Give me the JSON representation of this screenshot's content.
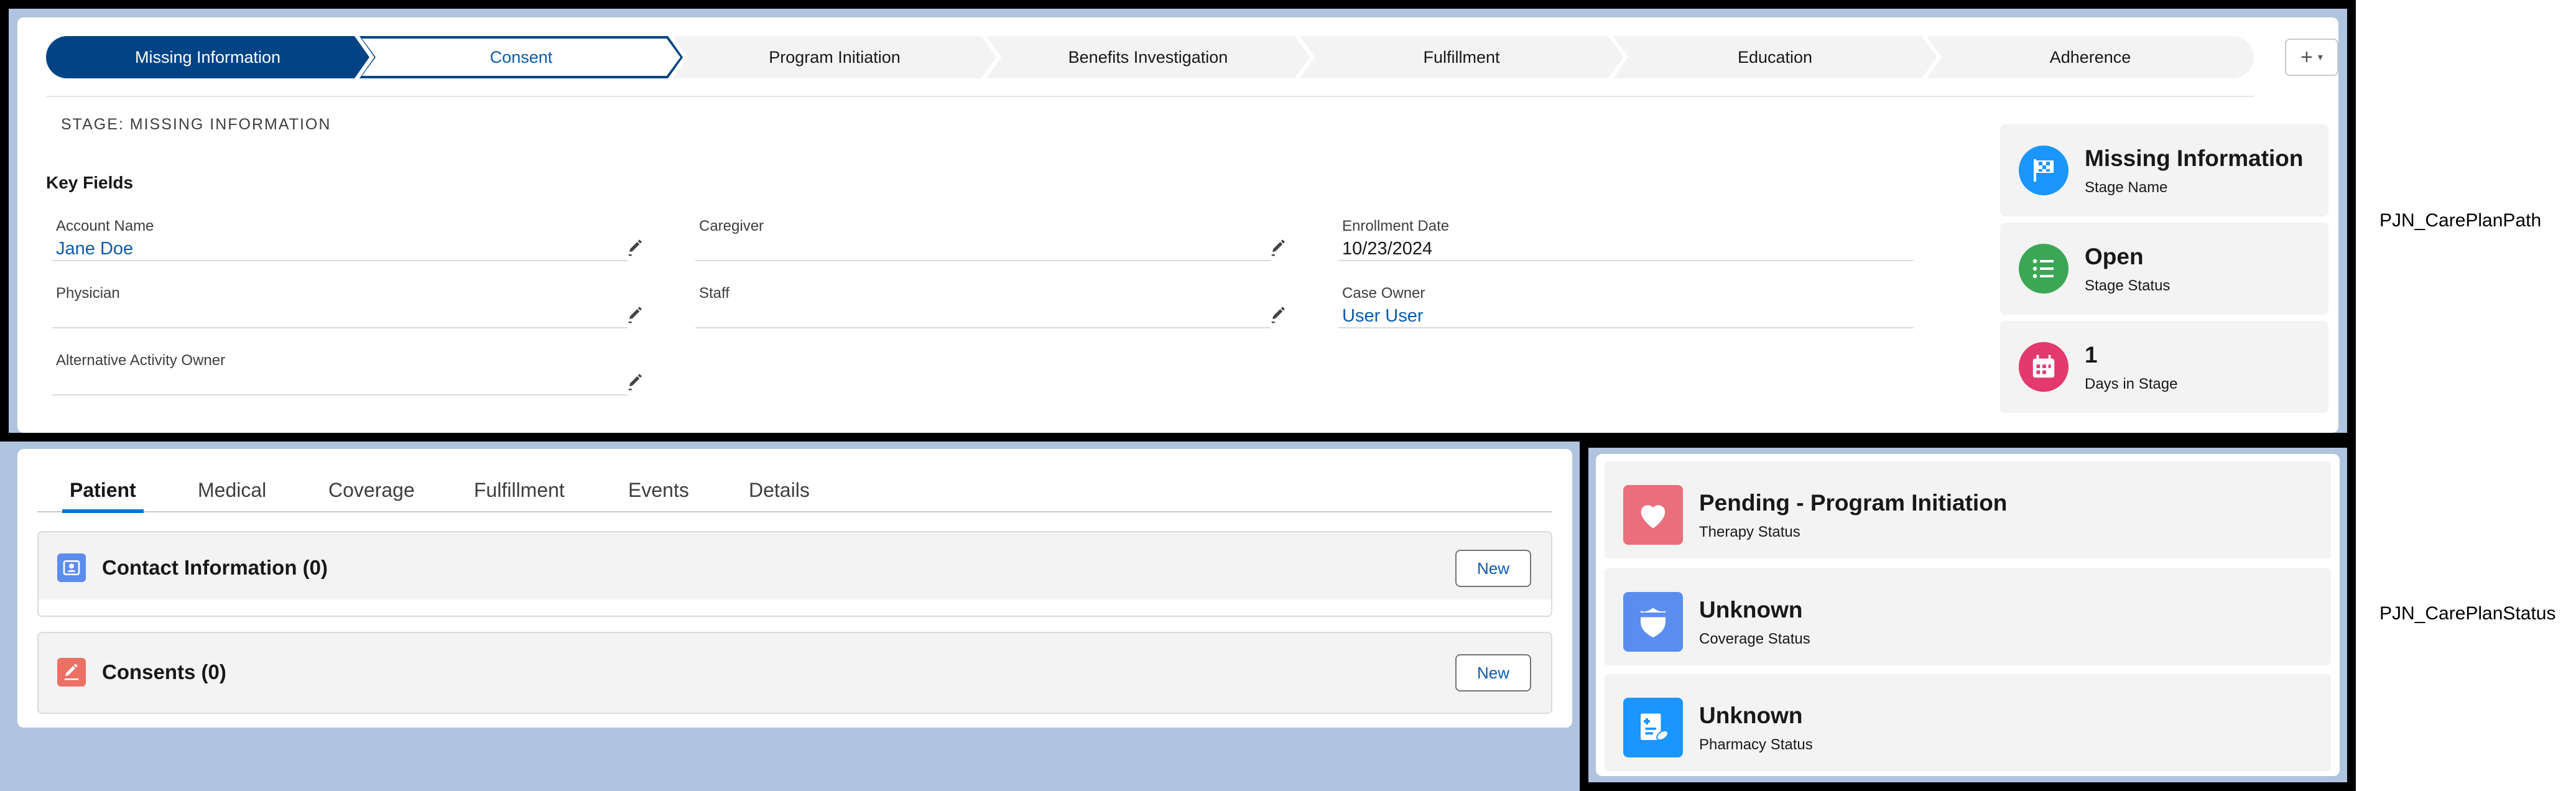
{
  "path": {
    "steps": [
      {
        "label": "Missing Information",
        "state": "current"
      },
      {
        "label": "Consent",
        "state": "selected"
      },
      {
        "label": "Program Initiation",
        "state": "incomplete"
      },
      {
        "label": "Benefits Investigation",
        "state": "incomplete"
      },
      {
        "label": "Fulfillment",
        "state": "incomplete"
      },
      {
        "label": "Education",
        "state": "incomplete"
      },
      {
        "label": "Adherence",
        "state": "incomplete"
      }
    ],
    "more_button_label": "+",
    "stage_label": "STAGE: MISSING INFORMATION",
    "key_fields_title": "Key Fields",
    "fields": {
      "account_name": {
        "label": "Account Name",
        "value": "Jane Doe"
      },
      "caregiver": {
        "label": "Caregiver",
        "value": ""
      },
      "enrollment_date": {
        "label": "Enrollment Date",
        "value": "10/23/2024"
      },
      "physician": {
        "label": "Physician",
        "value": ""
      },
      "staff": {
        "label": "Staff",
        "value": ""
      },
      "case_owner": {
        "label": "Case Owner",
        "value": "User User"
      },
      "alternative_activity_owner": {
        "label": "Alternative Activity Owner",
        "value": ""
      }
    },
    "stage_tiles": [
      {
        "value": "Missing Information",
        "label": "Stage Name",
        "icon": "flag-icon",
        "color": "#1b96ff"
      },
      {
        "value": "Open",
        "label": "Stage Status",
        "icon": "checklist-icon",
        "color": "#3ba755"
      },
      {
        "value": "1",
        "label": "Days in Stage",
        "icon": "calendar-icon",
        "color": "#e3396e"
      }
    ]
  },
  "tabs": {
    "items": [
      "Patient",
      "Medical",
      "Coverage",
      "Fulfillment",
      "Events",
      "Details"
    ],
    "active": "Patient"
  },
  "related_lists": [
    {
      "title": "Contact Information (0)",
      "new_label": "New",
      "icon": "contact-icon",
      "color": "#5b8def"
    },
    {
      "title": "Consents (0)",
      "new_label": "New",
      "icon": "edit-icon",
      "color": "#ec7063"
    }
  ],
  "status": {
    "tiles": [
      {
        "value": "Pending - Program Initiation",
        "label": "Therapy Status",
        "icon": "heart-icon",
        "color": "#ea6e7b"
      },
      {
        "value": "Unknown",
        "label": "Coverage Status",
        "icon": "shield-icon",
        "color": "#5b8def"
      },
      {
        "value": "Unknown",
        "label": "Pharmacy Status",
        "icon": "prescription-icon",
        "color": "#1b96ff"
      }
    ]
  },
  "side_labels": {
    "path": "PJN_CarePlanPath",
    "status": "PJN_CarePlanStatus"
  }
}
